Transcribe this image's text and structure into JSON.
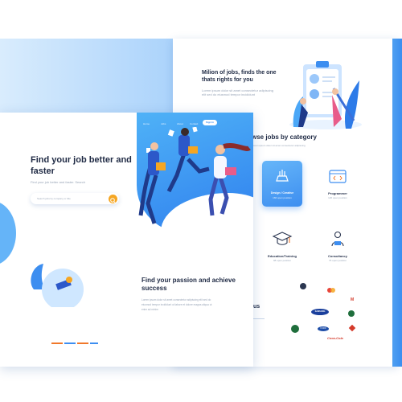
{
  "right_panel": {
    "headline": "Milion of jobs, finds the one thats rights for you",
    "blurb": "Lorem ipsum dolor sit amet consectetur adipiscing elit sed do eiusmod tempor incididunt",
    "section_title": "wse jobs by category",
    "section_sub": "Lorem ipsum dolor sit amet consectetur adipiscing",
    "categories": [
      {
        "label": "Design / Creative",
        "sub": "166 open position",
        "active": true,
        "icon": "design-icon"
      },
      {
        "label": "Programmer",
        "sub": "120 open position",
        "active": false,
        "icon": "code-icon"
      },
      {
        "label": "Education/Training",
        "sub": "98 open position",
        "active": false,
        "icon": "graduation-cap-icon"
      },
      {
        "label": "Consultancy",
        "sub": "76 open position",
        "active": false,
        "icon": "consultant-icon"
      }
    ],
    "partners_title": "us",
    "logos": [
      "SAMSUNG",
      "STARBUCKS",
      "FORD",
      "Coca-Cola",
      "M",
      "MITSUBISHI",
      "NIKE",
      "ADIDAS"
    ]
  },
  "hero": {
    "nav": [
      "Home",
      "Jobs",
      "About",
      "Contact"
    ],
    "signin": "Sign In",
    "title": "Find your job better and faster",
    "subtitle": "Find your job better and faster. Search",
    "search_placeholder": "Search jobs by company or title",
    "section2_title": "Find your passion and achieve success",
    "section2_text": "Lorem ipsum dolor sit amet consectetur adipiscing elit sed do eiusmod tempor incididunt ut labore et dolore magna aliqua ut enim ad minim"
  },
  "colors": {
    "accent": "#3d8ef0",
    "search": "#f5a623",
    "dots": [
      "#f0782a",
      "#3d8ef0",
      "#f0782a",
      "#3d8ef0"
    ]
  }
}
